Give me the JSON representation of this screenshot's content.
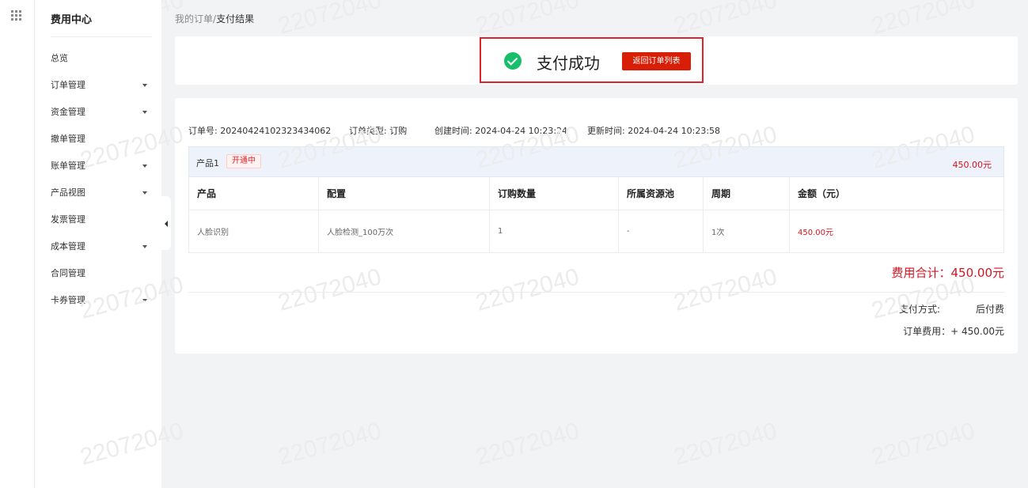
{
  "sidebar": {
    "title": "费用中心",
    "items": [
      {
        "label": "总览",
        "has_arrow": false
      },
      {
        "label": "订单管理",
        "has_arrow": true
      },
      {
        "label": "资金管理",
        "has_arrow": true
      },
      {
        "label": "撤单管理",
        "has_arrow": false
      },
      {
        "label": "账单管理",
        "has_arrow": true
      },
      {
        "label": "产品视图",
        "has_arrow": true
      },
      {
        "label": "发票管理",
        "has_arrow": false
      },
      {
        "label": "成本管理",
        "has_arrow": true
      },
      {
        "label": "合同管理",
        "has_arrow": false
      },
      {
        "label": "卡券管理",
        "has_arrow": true
      }
    ]
  },
  "breadcrumb": {
    "parent": "我的订单",
    "separator": "/",
    "current": "支付结果"
  },
  "result": {
    "text": "支付成功",
    "button_label": "返回订单列表"
  },
  "order": {
    "id_label": "订单号:",
    "id_value": "20240424102323434062",
    "type_label": "订单类型:",
    "type_value": "订购",
    "created_label": "创建时间:",
    "created_value": "2024-04-24 10:23:24",
    "updated_label": "更新时间:",
    "updated_value": "2024-04-24 10:23:58"
  },
  "product": {
    "name": "产品1",
    "status": "开通中",
    "price": "450.00元"
  },
  "table": {
    "headers": [
      "产品",
      "配置",
      "订购数量",
      "所属资源池",
      "周期",
      "金额（元）"
    ],
    "rows": [
      [
        "人脸识别",
        "人脸检测_100万次",
        "1",
        "-",
        "1次",
        "450.00元"
      ]
    ]
  },
  "summary": {
    "total": "费用合计：450.00元",
    "pay_method_label": "支付方式:",
    "pay_method_value": "后付费",
    "fee": "订单费用：+ 450.00元"
  },
  "watermark": "22072040",
  "colors": {
    "accent": "#d81e06",
    "success": "#19be6b",
    "price": "#d4141f"
  }
}
